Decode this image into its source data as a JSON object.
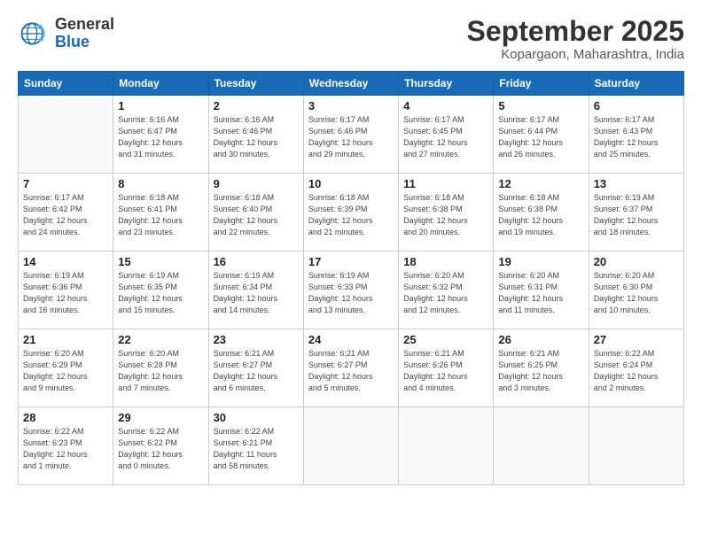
{
  "logo": {
    "line1": "General",
    "line2": "Blue"
  },
  "title": "September 2025",
  "subtitle": "Kopargaon, Maharashtra, India",
  "days_header": [
    "Sunday",
    "Monday",
    "Tuesday",
    "Wednesday",
    "Thursday",
    "Friday",
    "Saturday"
  ],
  "weeks": [
    [
      {
        "num": "",
        "info": ""
      },
      {
        "num": "1",
        "info": "Sunrise: 6:16 AM\nSunset: 6:47 PM\nDaylight: 12 hours\nand 31 minutes."
      },
      {
        "num": "2",
        "info": "Sunrise: 6:16 AM\nSunset: 6:46 PM\nDaylight: 12 hours\nand 30 minutes."
      },
      {
        "num": "3",
        "info": "Sunrise: 6:17 AM\nSunset: 6:46 PM\nDaylight: 12 hours\nand 29 minutes."
      },
      {
        "num": "4",
        "info": "Sunrise: 6:17 AM\nSunset: 6:45 PM\nDaylight: 12 hours\nand 27 minutes."
      },
      {
        "num": "5",
        "info": "Sunrise: 6:17 AM\nSunset: 6:44 PM\nDaylight: 12 hours\nand 26 minutes."
      },
      {
        "num": "6",
        "info": "Sunrise: 6:17 AM\nSunset: 6:43 PM\nDaylight: 12 hours\nand 25 minutes."
      }
    ],
    [
      {
        "num": "7",
        "info": "Sunrise: 6:17 AM\nSunset: 6:42 PM\nDaylight: 12 hours\nand 24 minutes."
      },
      {
        "num": "8",
        "info": "Sunrise: 6:18 AM\nSunset: 6:41 PM\nDaylight: 12 hours\nand 23 minutes."
      },
      {
        "num": "9",
        "info": "Sunrise: 6:18 AM\nSunset: 6:40 PM\nDaylight: 12 hours\nand 22 minutes."
      },
      {
        "num": "10",
        "info": "Sunrise: 6:18 AM\nSunset: 6:39 PM\nDaylight: 12 hours\nand 21 minutes."
      },
      {
        "num": "11",
        "info": "Sunrise: 6:18 AM\nSunset: 6:38 PM\nDaylight: 12 hours\nand 20 minutes."
      },
      {
        "num": "12",
        "info": "Sunrise: 6:18 AM\nSunset: 6:38 PM\nDaylight: 12 hours\nand 19 minutes."
      },
      {
        "num": "13",
        "info": "Sunrise: 6:19 AM\nSunset: 6:37 PM\nDaylight: 12 hours\nand 18 minutes."
      }
    ],
    [
      {
        "num": "14",
        "info": "Sunrise: 6:19 AM\nSunset: 6:36 PM\nDaylight: 12 hours\nand 16 minutes."
      },
      {
        "num": "15",
        "info": "Sunrise: 6:19 AM\nSunset: 6:35 PM\nDaylight: 12 hours\nand 15 minutes."
      },
      {
        "num": "16",
        "info": "Sunrise: 6:19 AM\nSunset: 6:34 PM\nDaylight: 12 hours\nand 14 minutes."
      },
      {
        "num": "17",
        "info": "Sunrise: 6:19 AM\nSunset: 6:33 PM\nDaylight: 12 hours\nand 13 minutes."
      },
      {
        "num": "18",
        "info": "Sunrise: 6:20 AM\nSunset: 6:32 PM\nDaylight: 12 hours\nand 12 minutes."
      },
      {
        "num": "19",
        "info": "Sunrise: 6:20 AM\nSunset: 6:31 PM\nDaylight: 12 hours\nand 11 minutes."
      },
      {
        "num": "20",
        "info": "Sunrise: 6:20 AM\nSunset: 6:30 PM\nDaylight: 12 hours\nand 10 minutes."
      }
    ],
    [
      {
        "num": "21",
        "info": "Sunrise: 6:20 AM\nSunset: 6:29 PM\nDaylight: 12 hours\nand 9 minutes."
      },
      {
        "num": "22",
        "info": "Sunrise: 6:20 AM\nSunset: 6:28 PM\nDaylight: 12 hours\nand 7 minutes."
      },
      {
        "num": "23",
        "info": "Sunrise: 6:21 AM\nSunset: 6:27 PM\nDaylight: 12 hours\nand 6 minutes."
      },
      {
        "num": "24",
        "info": "Sunrise: 6:21 AM\nSunset: 6:27 PM\nDaylight: 12 hours\nand 5 minutes."
      },
      {
        "num": "25",
        "info": "Sunrise: 6:21 AM\nSunset: 6:26 PM\nDaylight: 12 hours\nand 4 minutes."
      },
      {
        "num": "26",
        "info": "Sunrise: 6:21 AM\nSunset: 6:25 PM\nDaylight: 12 hours\nand 3 minutes."
      },
      {
        "num": "27",
        "info": "Sunrise: 6:22 AM\nSunset: 6:24 PM\nDaylight: 12 hours\nand 2 minutes."
      }
    ],
    [
      {
        "num": "28",
        "info": "Sunrise: 6:22 AM\nSunset: 6:23 PM\nDaylight: 12 hours\nand 1 minute."
      },
      {
        "num": "29",
        "info": "Sunrise: 6:22 AM\nSunset: 6:22 PM\nDaylight: 12 hours\nand 0 minutes."
      },
      {
        "num": "30",
        "info": "Sunrise: 6:22 AM\nSunset: 6:21 PM\nDaylight: 11 hours\nand 58 minutes."
      },
      {
        "num": "",
        "info": ""
      },
      {
        "num": "",
        "info": ""
      },
      {
        "num": "",
        "info": ""
      },
      {
        "num": "",
        "info": ""
      }
    ]
  ]
}
